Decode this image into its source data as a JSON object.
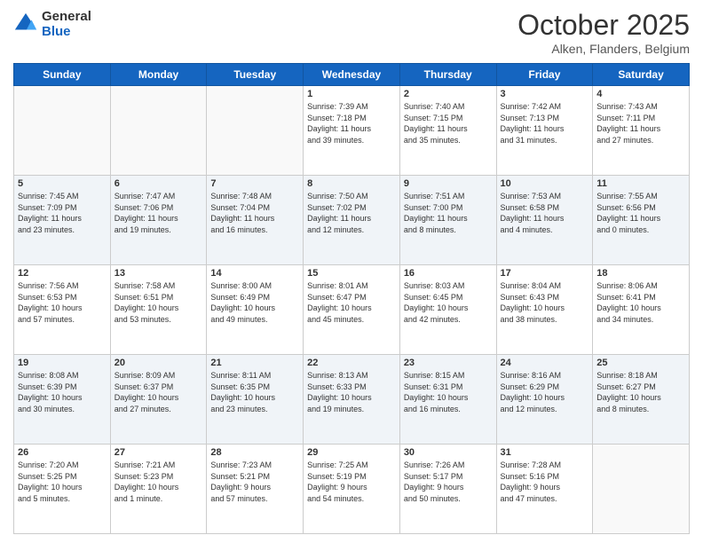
{
  "header": {
    "logo_line1": "General",
    "logo_line2": "Blue",
    "month": "October 2025",
    "location": "Alken, Flanders, Belgium"
  },
  "weekdays": [
    "Sunday",
    "Monday",
    "Tuesday",
    "Wednesday",
    "Thursday",
    "Friday",
    "Saturday"
  ],
  "weeks": [
    [
      {
        "day": "",
        "info": ""
      },
      {
        "day": "",
        "info": ""
      },
      {
        "day": "",
        "info": ""
      },
      {
        "day": "1",
        "info": "Sunrise: 7:39 AM\nSunset: 7:18 PM\nDaylight: 11 hours\nand 39 minutes."
      },
      {
        "day": "2",
        "info": "Sunrise: 7:40 AM\nSunset: 7:15 PM\nDaylight: 11 hours\nand 35 minutes."
      },
      {
        "day": "3",
        "info": "Sunrise: 7:42 AM\nSunset: 7:13 PM\nDaylight: 11 hours\nand 31 minutes."
      },
      {
        "day": "4",
        "info": "Sunrise: 7:43 AM\nSunset: 7:11 PM\nDaylight: 11 hours\nand 27 minutes."
      }
    ],
    [
      {
        "day": "5",
        "info": "Sunrise: 7:45 AM\nSunset: 7:09 PM\nDaylight: 11 hours\nand 23 minutes."
      },
      {
        "day": "6",
        "info": "Sunrise: 7:47 AM\nSunset: 7:06 PM\nDaylight: 11 hours\nand 19 minutes."
      },
      {
        "day": "7",
        "info": "Sunrise: 7:48 AM\nSunset: 7:04 PM\nDaylight: 11 hours\nand 16 minutes."
      },
      {
        "day": "8",
        "info": "Sunrise: 7:50 AM\nSunset: 7:02 PM\nDaylight: 11 hours\nand 12 minutes."
      },
      {
        "day": "9",
        "info": "Sunrise: 7:51 AM\nSunset: 7:00 PM\nDaylight: 11 hours\nand 8 minutes."
      },
      {
        "day": "10",
        "info": "Sunrise: 7:53 AM\nSunset: 6:58 PM\nDaylight: 11 hours\nand 4 minutes."
      },
      {
        "day": "11",
        "info": "Sunrise: 7:55 AM\nSunset: 6:56 PM\nDaylight: 11 hours\nand 0 minutes."
      }
    ],
    [
      {
        "day": "12",
        "info": "Sunrise: 7:56 AM\nSunset: 6:53 PM\nDaylight: 10 hours\nand 57 minutes."
      },
      {
        "day": "13",
        "info": "Sunrise: 7:58 AM\nSunset: 6:51 PM\nDaylight: 10 hours\nand 53 minutes."
      },
      {
        "day": "14",
        "info": "Sunrise: 8:00 AM\nSunset: 6:49 PM\nDaylight: 10 hours\nand 49 minutes."
      },
      {
        "day": "15",
        "info": "Sunrise: 8:01 AM\nSunset: 6:47 PM\nDaylight: 10 hours\nand 45 minutes."
      },
      {
        "day": "16",
        "info": "Sunrise: 8:03 AM\nSunset: 6:45 PM\nDaylight: 10 hours\nand 42 minutes."
      },
      {
        "day": "17",
        "info": "Sunrise: 8:04 AM\nSunset: 6:43 PM\nDaylight: 10 hours\nand 38 minutes."
      },
      {
        "day": "18",
        "info": "Sunrise: 8:06 AM\nSunset: 6:41 PM\nDaylight: 10 hours\nand 34 minutes."
      }
    ],
    [
      {
        "day": "19",
        "info": "Sunrise: 8:08 AM\nSunset: 6:39 PM\nDaylight: 10 hours\nand 30 minutes."
      },
      {
        "day": "20",
        "info": "Sunrise: 8:09 AM\nSunset: 6:37 PM\nDaylight: 10 hours\nand 27 minutes."
      },
      {
        "day": "21",
        "info": "Sunrise: 8:11 AM\nSunset: 6:35 PM\nDaylight: 10 hours\nand 23 minutes."
      },
      {
        "day": "22",
        "info": "Sunrise: 8:13 AM\nSunset: 6:33 PM\nDaylight: 10 hours\nand 19 minutes."
      },
      {
        "day": "23",
        "info": "Sunrise: 8:15 AM\nSunset: 6:31 PM\nDaylight: 10 hours\nand 16 minutes."
      },
      {
        "day": "24",
        "info": "Sunrise: 8:16 AM\nSunset: 6:29 PM\nDaylight: 10 hours\nand 12 minutes."
      },
      {
        "day": "25",
        "info": "Sunrise: 8:18 AM\nSunset: 6:27 PM\nDaylight: 10 hours\nand 8 minutes."
      }
    ],
    [
      {
        "day": "26",
        "info": "Sunrise: 7:20 AM\nSunset: 5:25 PM\nDaylight: 10 hours\nand 5 minutes."
      },
      {
        "day": "27",
        "info": "Sunrise: 7:21 AM\nSunset: 5:23 PM\nDaylight: 10 hours\nand 1 minute."
      },
      {
        "day": "28",
        "info": "Sunrise: 7:23 AM\nSunset: 5:21 PM\nDaylight: 9 hours\nand 57 minutes."
      },
      {
        "day": "29",
        "info": "Sunrise: 7:25 AM\nSunset: 5:19 PM\nDaylight: 9 hours\nand 54 minutes."
      },
      {
        "day": "30",
        "info": "Sunrise: 7:26 AM\nSunset: 5:17 PM\nDaylight: 9 hours\nand 50 minutes."
      },
      {
        "day": "31",
        "info": "Sunrise: 7:28 AM\nSunset: 5:16 PM\nDaylight: 9 hours\nand 47 minutes."
      },
      {
        "day": "",
        "info": ""
      }
    ]
  ]
}
